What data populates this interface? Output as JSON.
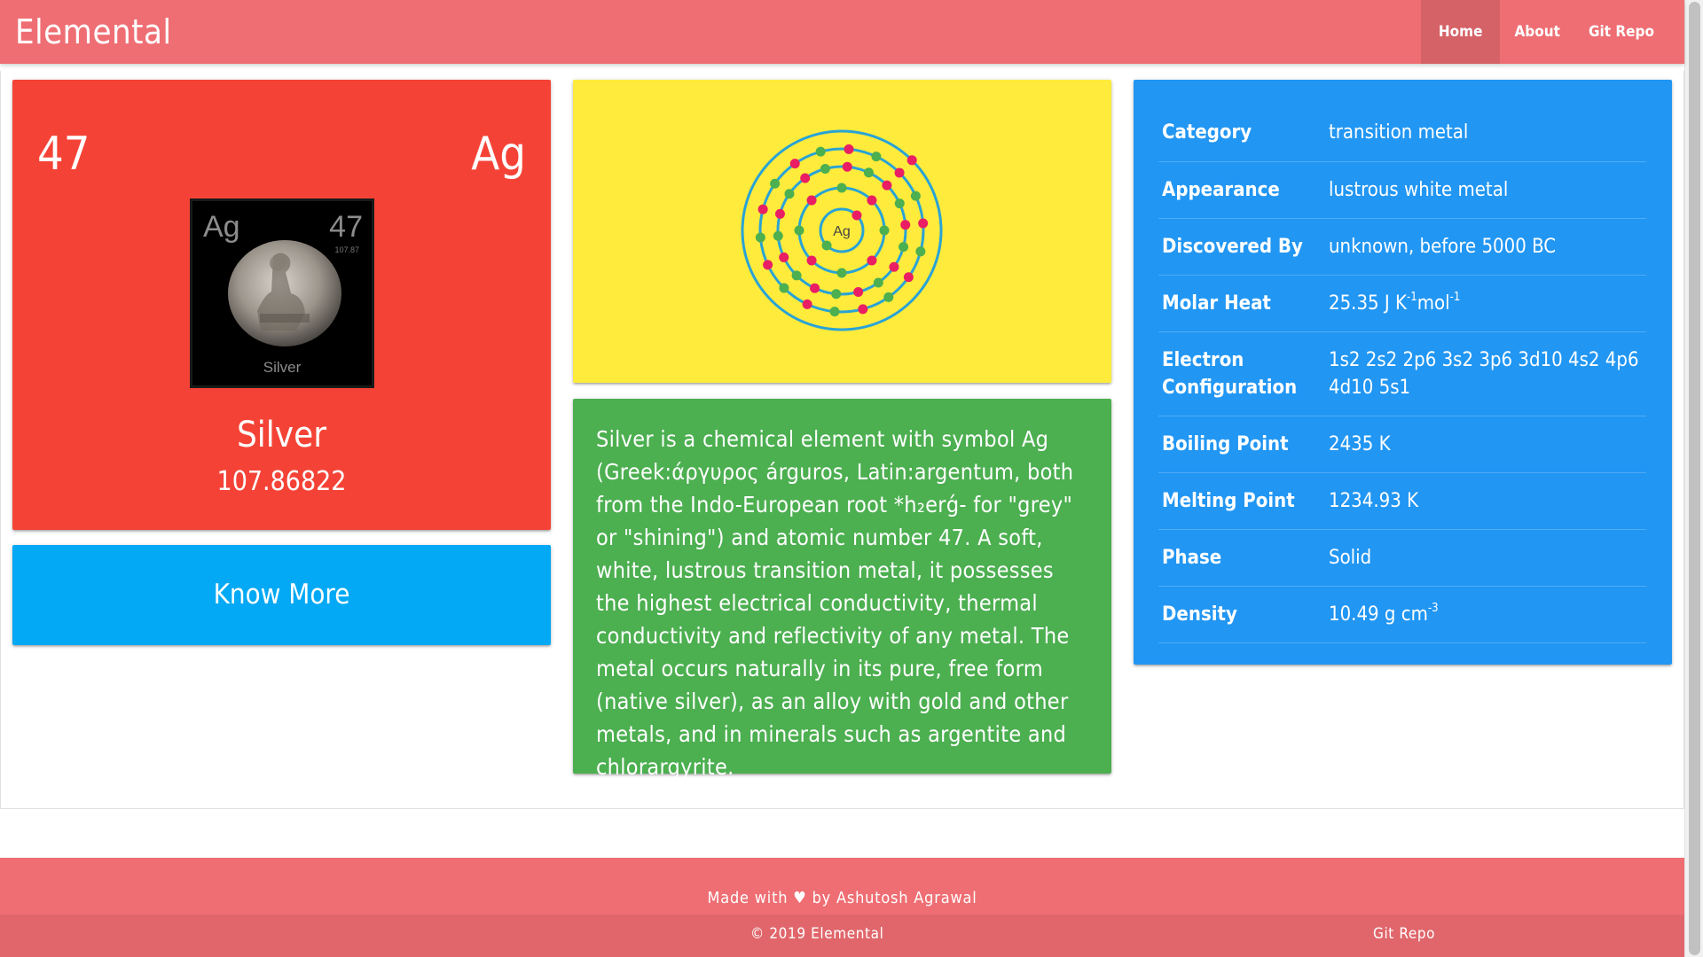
{
  "nav": {
    "brand": "Elemental",
    "links": [
      "Home",
      "About",
      "Git Repo"
    ],
    "active": "Home"
  },
  "element": {
    "number": "47",
    "symbol": "Ag",
    "name": "Silver",
    "mass": "107.86822",
    "image": {
      "symbol": "Ag",
      "number": "47",
      "mass": "107.87",
      "name": "Silver"
    }
  },
  "know_more": "Know More",
  "bohr_model": {
    "symbol": "Ag",
    "shells": [
      2,
      8,
      18,
      18,
      1
    ]
  },
  "description": "Silver is a chemical element with symbol Ag (Greek:άργυρος árguros, Latin:argentum, both from the Indo-European root *h₂erǵ- for \"grey\" or \"shining\") and atomic number 47. A soft, white, lustrous transition metal, it possesses the highest electrical conductivity, thermal conductivity and reflectivity of any metal. The metal occurs naturally in its pure, free form (native silver), as an alloy with gold and other metals, and in minerals such as argentite and chlorargyrite.",
  "properties": {
    "category": {
      "label": "Category",
      "value": "transition metal"
    },
    "appearance": {
      "label": "Appearance",
      "value": "lustrous white metal"
    },
    "discovered_by": {
      "label": "Discovered By",
      "value": "unknown, before 5000 BC"
    },
    "molar_heat": {
      "label": "Molar Heat",
      "value": "25.35 J K",
      "sup1": "-1",
      "mid": "mol",
      "sup2": "-1"
    },
    "electron_config": {
      "label": "Electron Configuration",
      "value": "1s2 2s2 2p6 3s2 3p6 3d10 4s2 4p6 4d10 5s1"
    },
    "boiling_point": {
      "label": "Boiling Point",
      "value": "2435 K"
    },
    "melting_point": {
      "label": "Melting Point",
      "value": "1234.93 K"
    },
    "phase": {
      "label": "Phase",
      "value": "Solid"
    },
    "density": {
      "label": "Density",
      "value": "10.49 g cm",
      "sup": "-3"
    }
  },
  "footer": {
    "made_with_prefix": "Made with",
    "heart": "♥",
    "made_with_suffix": "by Ashutosh Agrawal",
    "copyright": "© 2019 Elemental",
    "repo": "Git Repo"
  },
  "colors": {
    "navbar": "#ee6e73",
    "element_card": "#f44336",
    "know_more": "#03a9f4",
    "bohr_card": "#ffeb3b",
    "description_card": "#4caf50",
    "properties_card": "#2196f3",
    "orbit": "#29a3d6",
    "electron_red": "#e91e63",
    "electron_green": "#4caf50"
  }
}
